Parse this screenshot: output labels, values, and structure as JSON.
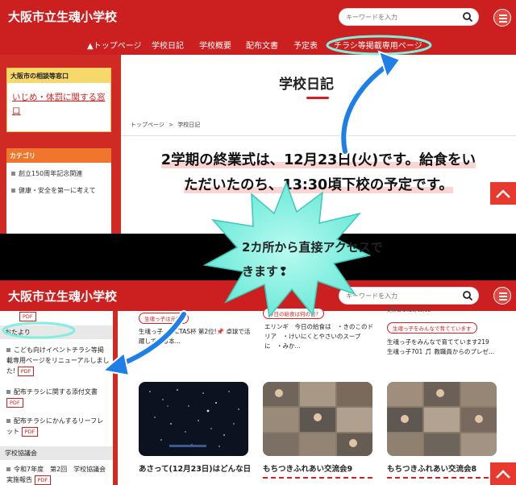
{
  "site": {
    "title": "大阪市立生魂小学校",
    "search_placeholder": "キーワードを入力"
  },
  "nav": [
    "トップページ",
    "学校日記",
    "学校概要",
    "配布文書",
    "予定表",
    "チラシ等掲載専用ページ"
  ],
  "sidebar1": {
    "consult_header": "大阪市の相談等窓口",
    "consult_link": "いじめ・体罰に関する窓口",
    "category_header": "カテゴリ",
    "categories": [
      "創立150周年記念関連",
      "健康・安全を第一に考えて"
    ]
  },
  "main1": {
    "page_title": "学校日記",
    "breadcrumb_home": "トップページ",
    "breadcrumb_sep": ">",
    "breadcrumb_current": "学校日記"
  },
  "headline": {
    "line1": "2学期の終業式は、12月23日(火)です。給食をい",
    "line2": "ただいたのち、13:30頃下校の予定です。"
  },
  "callout": {
    "text": "2カ所から直接アクセスできます❢"
  },
  "sidebar2": {
    "pdf_label": "PDF",
    "section1": "おたより",
    "items1": [
      "こども向けイベントチラシ等掲載専用ページをリニューアルしました!",
      "配布チラシに関する添付文書",
      "配布チラシにかんするリーフレット"
    ],
    "section2": "学校協議会",
    "items2": [
      "令和7年度　第2回　学校協議会実施報告"
    ]
  },
  "posts": [
    {
      "tag": "生魂っ子は元気!",
      "snippet": "生魂っ子　VICTAS杯 第2位!📌 卓球で活躍している本...",
      "caption": "あさって(12月23日)はどんな日"
    },
    {
      "tag": "今日の給食は何の日?",
      "snippet": "エリンギ　今日の給食は　・きのこのドリア　・けいにくとやさいのスープに　・みか...",
      "caption": "もちつきふれあい交流会9"
    },
    {
      "tag": "生魂っ子をみんなで育てています",
      "date": "更新日:2025/12/22",
      "snippet": "生魂っ子をみんなで育てています219 生魂っ子701 🎵 教職員からのプレゼ...",
      "caption": "もちつきふれあい交流会8"
    }
  ],
  "colors": {
    "brand_red": "#cc1f1f",
    "accent_teal": "#7ff0e0",
    "arrow_blue": "#1f7fe8"
  }
}
